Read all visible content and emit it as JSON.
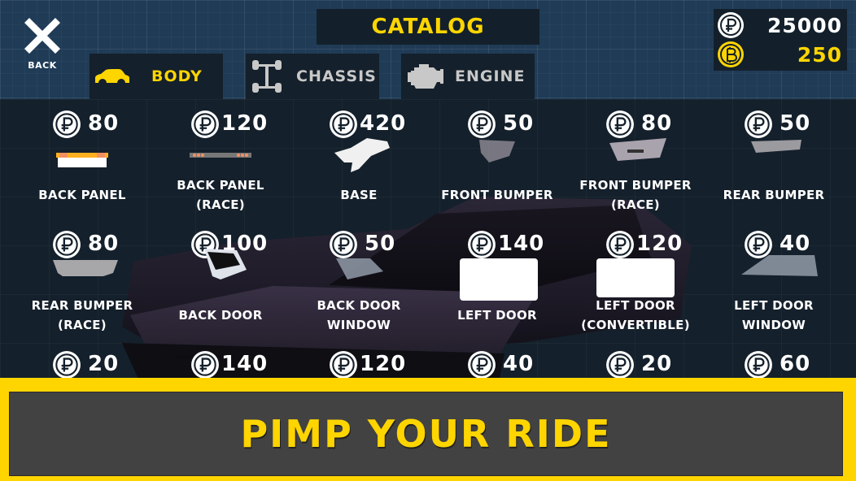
{
  "header": {
    "title": "CATALOG",
    "back_label": "BACK"
  },
  "tabs": [
    {
      "label": "BODY",
      "icon": "car-icon",
      "active": true
    },
    {
      "label": "CHASSIS",
      "icon": "chassis-icon",
      "active": false
    },
    {
      "label": "ENGINE",
      "icon": "engine-icon",
      "active": false
    }
  ],
  "wallet": {
    "rubles": "25000",
    "bitcoin": "250"
  },
  "colors": {
    "accent": "#ffd500",
    "panel": "#14202b",
    "background": "#1f3b56",
    "cta_background": "#424242"
  },
  "items": [
    {
      "name_1": "BACK PANEL",
      "name_2": "",
      "price": "80",
      "currency": "ruble"
    },
    {
      "name_1": "BACK PANEL",
      "name_2": "(RACE)",
      "price": "120",
      "currency": "ruble"
    },
    {
      "name_1": "BASE",
      "name_2": "",
      "price": "420",
      "currency": "ruble"
    },
    {
      "name_1": "FRONT BUMPER",
      "name_2": "",
      "price": "50",
      "currency": "ruble"
    },
    {
      "name_1": "FRONT BUMPER",
      "name_2": "(RACE)",
      "price": "80",
      "currency": "ruble"
    },
    {
      "name_1": "REAR BUMPER",
      "name_2": "",
      "price": "50",
      "currency": "ruble"
    },
    {
      "name_1": "REAR BUMPER",
      "name_2": "(RACE)",
      "price": "80",
      "currency": "ruble"
    },
    {
      "name_1": "BACK DOOR",
      "name_2": "",
      "price": "100",
      "currency": "ruble"
    },
    {
      "name_1": "BACK DOOR",
      "name_2": "WINDOW",
      "price": "50",
      "currency": "ruble"
    },
    {
      "name_1": "LEFT DOOR",
      "name_2": "",
      "price": "140",
      "currency": "ruble"
    },
    {
      "name_1": "LEFT DOOR",
      "name_2": "(CONVERTIBLE)",
      "price": "120",
      "currency": "ruble"
    },
    {
      "name_1": "LEFT DOOR",
      "name_2": "WINDOW",
      "price": "40",
      "currency": "ruble"
    },
    {
      "name_1": "",
      "name_2": "",
      "price": "20",
      "currency": "ruble"
    },
    {
      "name_1": "",
      "name_2": "",
      "price": "140",
      "currency": "ruble"
    },
    {
      "name_1": "",
      "name_2": "",
      "price": "120",
      "currency": "ruble"
    },
    {
      "name_1": "",
      "name_2": "",
      "price": "40",
      "currency": "ruble"
    },
    {
      "name_1": "",
      "name_2": "",
      "price": "20",
      "currency": "ruble"
    },
    {
      "name_1": "",
      "name_2": "",
      "price": "60",
      "currency": "ruble"
    }
  ],
  "cta": {
    "label": "PIMP YOUR RIDE"
  }
}
